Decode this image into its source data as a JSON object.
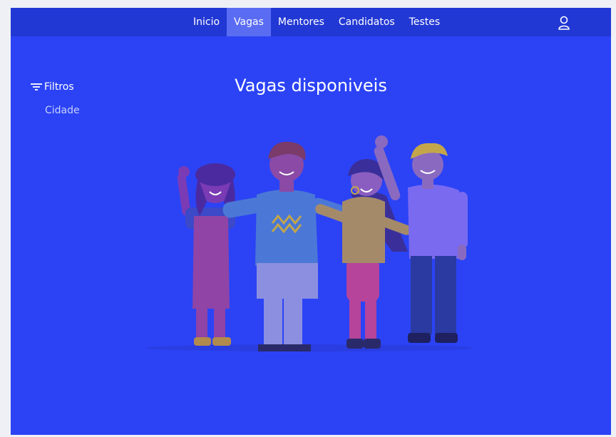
{
  "nav": {
    "items": [
      {
        "label": "Inicio",
        "active": false
      },
      {
        "label": "Vagas",
        "active": true
      },
      {
        "label": "Mentores",
        "active": false
      },
      {
        "label": "Candidatos",
        "active": false
      },
      {
        "label": "Testes",
        "active": false
      }
    ],
    "user_icon": "user-icon"
  },
  "sidebar": {
    "filters_label": "Filtros",
    "filters_icon": "filter-icon",
    "filter_items": [
      "Cidade"
    ]
  },
  "main": {
    "title": "Vagas disponiveis"
  },
  "colors": {
    "background": "#2b43f5",
    "topbar": "#2238d4",
    "active_tab": "#5a6cf2"
  }
}
